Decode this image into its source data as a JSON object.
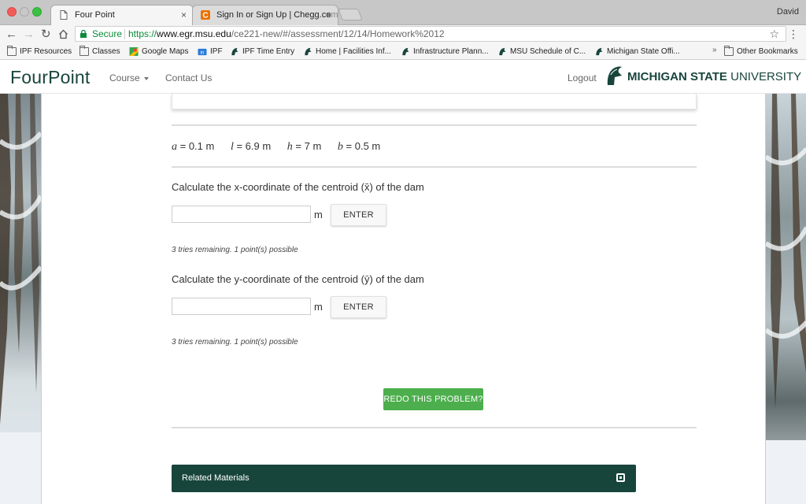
{
  "browser": {
    "tabs": [
      {
        "title": "Four Point",
        "active": true
      },
      {
        "title": "Sign In or Sign Up | Chegg.com",
        "title_visible": "Sign In or Sign Up | Chegg.co",
        "title_faded": "m",
        "active": false
      }
    ],
    "profile_name": "David",
    "omnibox": {
      "secure_label": "Secure",
      "url_scheme": "https://",
      "url_host": "www.egr.msu.edu",
      "url_path": "/ce221-new/#/assessment/12/14/Homework%2012"
    },
    "bookmarks": [
      {
        "label": "IPF Resources",
        "icon": "folder-icon"
      },
      {
        "label": "Classes",
        "icon": "folder-icon"
      },
      {
        "label": "Google Maps",
        "icon": "maps-icon"
      },
      {
        "label": "IPF",
        "icon": "ipf-icon"
      },
      {
        "label": "IPF Time Entry",
        "icon": "spartan-icon"
      },
      {
        "label": "Home | Facilities Inf...",
        "icon": "spartan-icon"
      },
      {
        "label": "Infrastructure Plann...",
        "icon": "spartan-icon"
      },
      {
        "label": "MSU Schedule of C...",
        "icon": "spartan-icon"
      },
      {
        "label": "Michigan State Offi...",
        "icon": "spartan-icon"
      }
    ],
    "bookmarks_more": "»",
    "other_bookmarks": "Other Bookmarks"
  },
  "site": {
    "brand": "FourPoint",
    "nav": {
      "course": "Course",
      "contact": "Contact Us"
    },
    "logout": "Logout",
    "university_bold": "MICHIGAN STATE",
    "university_regular": " UNIVERSITY"
  },
  "problem": {
    "variables": [
      {
        "symbol": "a",
        "value": " = 0.1 m"
      },
      {
        "symbol": "l",
        "value": " = 6.9 m"
      },
      {
        "symbol": "h",
        "value": " = 7 m"
      },
      {
        "symbol": "b",
        "value": " = 0.5 m"
      }
    ],
    "questions": [
      {
        "prompt": "Calculate the x-coordinate of the centroid (x̄) of the dam",
        "answer": "",
        "unit": "m",
        "button": "ENTER",
        "tries": "3 tries remaining. 1 point(s) possible"
      },
      {
        "prompt": "Calculate the y-coordinate of the centroid (ȳ) of the dam",
        "answer": "",
        "unit": "m",
        "button": "ENTER",
        "tries": "3 tries remaining. 1 point(s) possible"
      }
    ],
    "redo_button": "REDO THIS PROBLEM?",
    "related_materials": "Related Materials"
  },
  "colors": {
    "msu_green": "#18453b",
    "redo_green": "#4cae4c",
    "secure_green": "#0a8a3a"
  }
}
